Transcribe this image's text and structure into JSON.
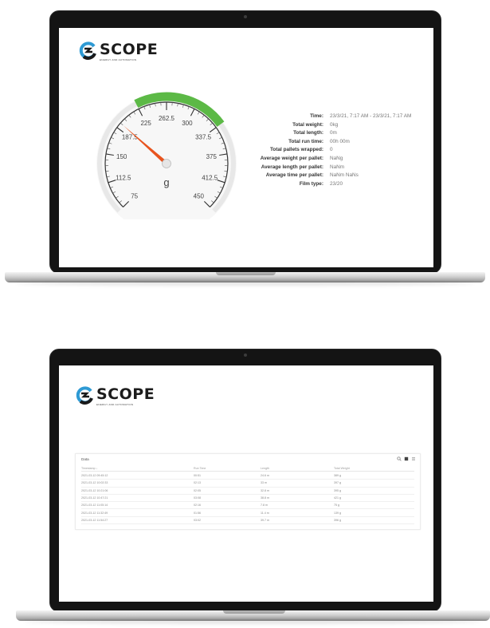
{
  "top_laptop": {
    "logo": {
      "name": "SCOPE",
      "tagline": "ENERGY AND AUTOMATION"
    },
    "gauge": {
      "unit": "g",
      "min": 75,
      "max": 450,
      "value": 195,
      "ticks": [
        "75",
        "112.5",
        "150",
        "187.5",
        "225",
        "262.5",
        "300",
        "337.5",
        "375",
        "412.5",
        "450"
      ],
      "green_band": [
        225,
        337.5
      ],
      "colors": {
        "band": "#5cb946",
        "needle": "#e8541e",
        "rim": "#e8e8e8"
      }
    },
    "info": [
      {
        "label": "Time:",
        "value": "23/3/21, 7:17 AM - 23/3/21, 7:17 AM"
      },
      {
        "label": "Total weight:",
        "value": "0kg"
      },
      {
        "label": "Total length:",
        "value": "0m"
      },
      {
        "label": "Total run time:",
        "value": "00h 00m"
      },
      {
        "label": "Total pallets wrapped:",
        "value": "0"
      },
      {
        "label": "Average weight per pallet:",
        "value": "NaNg"
      },
      {
        "label": "Average length per pallet:",
        "value": "NaNm"
      },
      {
        "label": "Average time per pallet:",
        "value": "NaNm NaNs"
      },
      {
        "label": "Film type:",
        "value": "23/20"
      }
    ]
  },
  "bottom_laptop": {
    "logo": {
      "name": "SCOPE",
      "tagline": "ENERGY AND AUTOMATION"
    },
    "table": {
      "title": "Data",
      "tools": [
        "search-icon",
        "download-icon",
        "menu-icon"
      ],
      "columns": [
        "Timestamp ↓",
        "Run Time",
        "Length",
        "Total Weight"
      ],
      "rows": [
        [
          "2021-03-12 09:45:12",
          "00:51",
          "24.6 m",
          "389 g"
        ],
        [
          "2021-03-12 10:02:33",
          "02:13",
          "33 m",
          "397 g"
        ],
        [
          "2021-03-12 10:21:06",
          "02:05",
          "32.8 m",
          "395 g"
        ],
        [
          "2021-03-12 10:47:21",
          "03:08",
          "38.8 m",
          "421 g"
        ],
        [
          "2021-03-12 11:05:14",
          "02:16",
          "7.8 m",
          "75 g"
        ],
        [
          "2021-03-12 11:32:49",
          "01:56",
          "11.4 m",
          "139 g"
        ],
        [
          "2021-03-12 11:54:27",
          "03:02",
          "39.7 m",
          "396 g"
        ]
      ]
    }
  }
}
